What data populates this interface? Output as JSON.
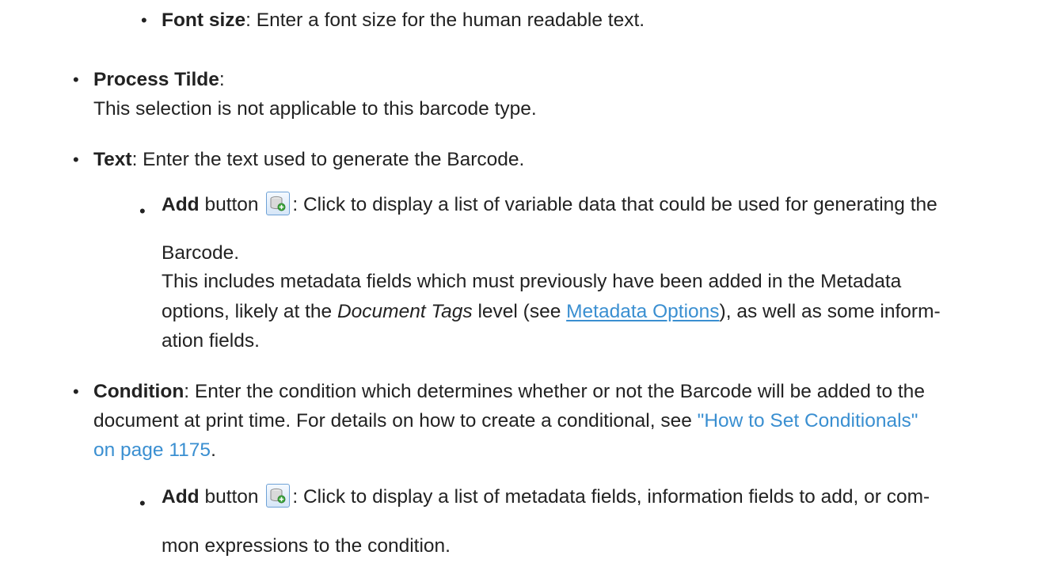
{
  "items": {
    "font_size": {
      "label": "Font size",
      "text": ": Enter a font size for the human readable text."
    },
    "process_tilde": {
      "label": "Process Tilde",
      "colon": ":",
      "text": "This selection is not applicable to this barcode type."
    },
    "text": {
      "label": "Text",
      "text": ": Enter the text used to generate the Barcode."
    },
    "text_add": {
      "label": "Add",
      "word": "button",
      "icon": "database-add-icon",
      "text1": ": Click to display a list of variable data that could be used for generating the",
      "text2": "Barcode.",
      "text3": "This includes metadata fields which must previously have been added in the Metadata",
      "text4a": "options, likely at the ",
      "text4_italic": "Document Tags",
      "text4b": " level (see ",
      "text4_link": "Metadata Options",
      "text4c": "), as well as some inform-",
      "text5": "ation fields."
    },
    "condition": {
      "label": "Condition",
      "text1": ": Enter the condition which determines whether or not the Barcode will be added to the",
      "text2a": "document at print time. For details on how to create a conditional, see ",
      "text2_link": "\"How to Set Conditionals\"",
      "text3_link": "on page 1175",
      "text3b": "."
    },
    "condition_add": {
      "label": "Add",
      "word": "button",
      "icon": "database-add-icon",
      "text1": ": Click to display a list of metadata fields, information fields to add, or com-",
      "text2": "mon expressions to the condition."
    }
  },
  "colors": {
    "text": "#222222",
    "link": "#3a8fd1",
    "icon_border": "#6fa2d6"
  }
}
